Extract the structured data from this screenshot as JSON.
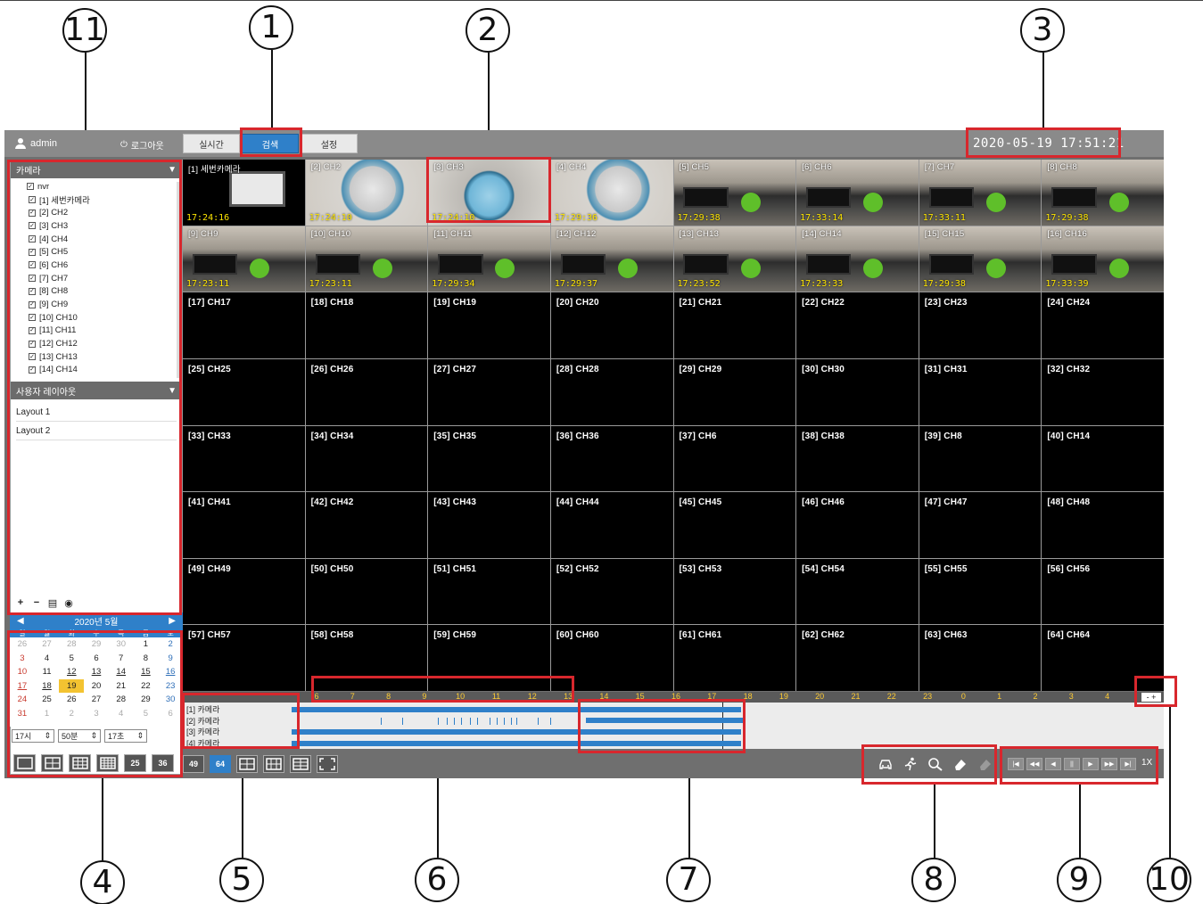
{
  "callouts": [
    "1",
    "2",
    "3",
    "4",
    "5",
    "6",
    "7",
    "8",
    "9",
    "10",
    "11"
  ],
  "header": {
    "user": "admin",
    "logout": "로그아웃",
    "tabs": [
      {
        "label": "실시간",
        "active": false
      },
      {
        "label": "검색",
        "active": true
      },
      {
        "label": "설정",
        "active": false
      }
    ],
    "datetime": "2020-05-19 17:51:21"
  },
  "sidebar": {
    "camera_section": "카메라",
    "root": "nvr",
    "cameras": [
      "[1] 세번카메라",
      "[2] CH2",
      "[3] CH3",
      "[4] CH4",
      "[5] CH5",
      "[6] CH6",
      "[7] CH7",
      "[8] CH8",
      "[9] CH9",
      "[10] CH10",
      "[11] CH11",
      "[12] CH12",
      "[13] CH13",
      "[14] CH14"
    ],
    "layout_section": "사용자 레이아웃",
    "layouts": [
      "Layout 1",
      "Layout 2"
    ]
  },
  "calendar": {
    "title": "2020년 5월",
    "dow": [
      "일",
      "월",
      "화",
      "수",
      "목",
      "금",
      "토"
    ],
    "days": [
      {
        "d": "26",
        "other": true
      },
      {
        "d": "27",
        "other": true
      },
      {
        "d": "28",
        "other": true
      },
      {
        "d": "29",
        "other": true
      },
      {
        "d": "30",
        "other": true
      },
      {
        "d": "1"
      },
      {
        "d": "2"
      },
      {
        "d": "3"
      },
      {
        "d": "4"
      },
      {
        "d": "5"
      },
      {
        "d": "6"
      },
      {
        "d": "7"
      },
      {
        "d": "8"
      },
      {
        "d": "9"
      },
      {
        "d": "10"
      },
      {
        "d": "11"
      },
      {
        "d": "12",
        "rec": true
      },
      {
        "d": "13",
        "rec": true
      },
      {
        "d": "14",
        "rec": true
      },
      {
        "d": "15",
        "rec": true
      },
      {
        "d": "16",
        "rec": true
      },
      {
        "d": "17",
        "rec": true
      },
      {
        "d": "18",
        "rec": true
      },
      {
        "d": "19",
        "sel": true
      },
      {
        "d": "20"
      },
      {
        "d": "21"
      },
      {
        "d": "22"
      },
      {
        "d": "23"
      },
      {
        "d": "24"
      },
      {
        "d": "25"
      },
      {
        "d": "26"
      },
      {
        "d": "27"
      },
      {
        "d": "28"
      },
      {
        "d": "29"
      },
      {
        "d": "30"
      },
      {
        "d": "31"
      },
      {
        "d": "1",
        "other": true
      },
      {
        "d": "2",
        "other": true
      },
      {
        "d": "3",
        "other": true
      },
      {
        "d": "4",
        "other": true
      },
      {
        "d": "5",
        "other": true
      },
      {
        "d": "6",
        "other": true
      }
    ],
    "hour": "17시",
    "minute": "50분",
    "second": "17초"
  },
  "splits": [
    "1",
    "4",
    "9",
    "16",
    "25",
    "36"
  ],
  "bottom_splits": [
    "49",
    "64",
    "",
    "",
    "",
    ""
  ],
  "tiles": [
    {
      "label": "[1] 세번카메라",
      "ts": "17:24:16",
      "scene": "first"
    },
    {
      "label": "[2] CH2",
      "ts": "17:24:10",
      "scene": "clock"
    },
    {
      "label": "[3] CH3",
      "ts": "17:24:10",
      "scene": "clock2"
    },
    {
      "label": "[4] CH4",
      "ts": "17:29:36",
      "scene": "clock"
    },
    {
      "label": "[5] CH5",
      "ts": "17:29:38",
      "scene": "office"
    },
    {
      "label": "[6] CH6",
      "ts": "17:33:14",
      "scene": "office"
    },
    {
      "label": "[7] CH7",
      "ts": "17:33:11",
      "scene": "office"
    },
    {
      "label": "[8] CH8",
      "ts": "17:29:38",
      "scene": "office"
    },
    {
      "label": "[9] CH9",
      "ts": "17:23:11",
      "scene": "office"
    },
    {
      "label": "[10] CH10",
      "ts": "17:23:11",
      "scene": "office"
    },
    {
      "label": "[11] CH11",
      "ts": "17:29:34",
      "scene": "office"
    },
    {
      "label": "[12] CH12",
      "ts": "17:29:37",
      "scene": "office"
    },
    {
      "label": "[13] CH13",
      "ts": "17:23:52",
      "scene": "office"
    },
    {
      "label": "[14] CH14",
      "ts": "17:23:33",
      "scene": "office"
    },
    {
      "label": "[15] CH15",
      "ts": "17:29:38",
      "scene": "office"
    },
    {
      "label": "[16] CH16",
      "ts": "17:33:39",
      "scene": "office"
    },
    {
      "label": "[17] CH17"
    },
    {
      "label": "[18] CH18"
    },
    {
      "label": "[19] CH19"
    },
    {
      "label": "[20] CH20"
    },
    {
      "label": "[21] CH21"
    },
    {
      "label": "[22] CH22"
    },
    {
      "label": "[23] CH23"
    },
    {
      "label": "[24] CH24"
    },
    {
      "label": "[25] CH25"
    },
    {
      "label": "[26] CH26"
    },
    {
      "label": "[27] CH27"
    },
    {
      "label": "[28] CH28"
    },
    {
      "label": "[29] CH29"
    },
    {
      "label": "[30] CH30"
    },
    {
      "label": "[31] CH31"
    },
    {
      "label": "[32] CH32"
    },
    {
      "label": "[33] CH33"
    },
    {
      "label": "[34] CH34"
    },
    {
      "label": "[35] CH35"
    },
    {
      "label": "[36] CH36"
    },
    {
      "label": "[37] CH6"
    },
    {
      "label": "[38] CH38"
    },
    {
      "label": "[39] CH8"
    },
    {
      "label": "[40] CH14"
    },
    {
      "label": "[41] CH41"
    },
    {
      "label": "[42] CH42"
    },
    {
      "label": "[43] CH43"
    },
    {
      "label": "[44] CH44"
    },
    {
      "label": "[45] CH45"
    },
    {
      "label": "[46] CH46"
    },
    {
      "label": "[47] CH47"
    },
    {
      "label": "[48] CH48"
    },
    {
      "label": "[49] CH49"
    },
    {
      "label": "[50] CH50"
    },
    {
      "label": "[51] CH51"
    },
    {
      "label": "[52] CH52"
    },
    {
      "label": "[53] CH53"
    },
    {
      "label": "[54] CH54"
    },
    {
      "label": "[55] CH55"
    },
    {
      "label": "[56] CH56"
    },
    {
      "label": "[57] CH57"
    },
    {
      "label": "[58] CH58"
    },
    {
      "label": "[59] CH59"
    },
    {
      "label": "[60] CH60"
    },
    {
      "label": "[61] CH61"
    },
    {
      "label": "[62] CH62"
    },
    {
      "label": "[63] CH63"
    },
    {
      "label": "[64] CH64"
    }
  ],
  "timeline": {
    "hours": [
      "6",
      "7",
      "8",
      "9",
      "10",
      "11",
      "12",
      "13",
      "14",
      "15",
      "16",
      "17",
      "18",
      "19",
      "20",
      "21",
      "22",
      "23",
      "0",
      "1",
      "2",
      "3",
      "4"
    ],
    "zoom": "-  +",
    "tracks": [
      "[1] 카메라",
      "[2] 카메라",
      "[3] 카메라",
      "[4] 카메라"
    ]
  },
  "search_tools": [
    "car-icon",
    "motion-icon",
    "zoom-search-icon",
    "eraser-icon",
    "eraser-disabled-icon"
  ],
  "playback": {
    "buttons": [
      "|◀",
      "◀◀",
      "◀",
      "||",
      "▶",
      "▶▶",
      "▶|"
    ],
    "speed": "1X"
  }
}
